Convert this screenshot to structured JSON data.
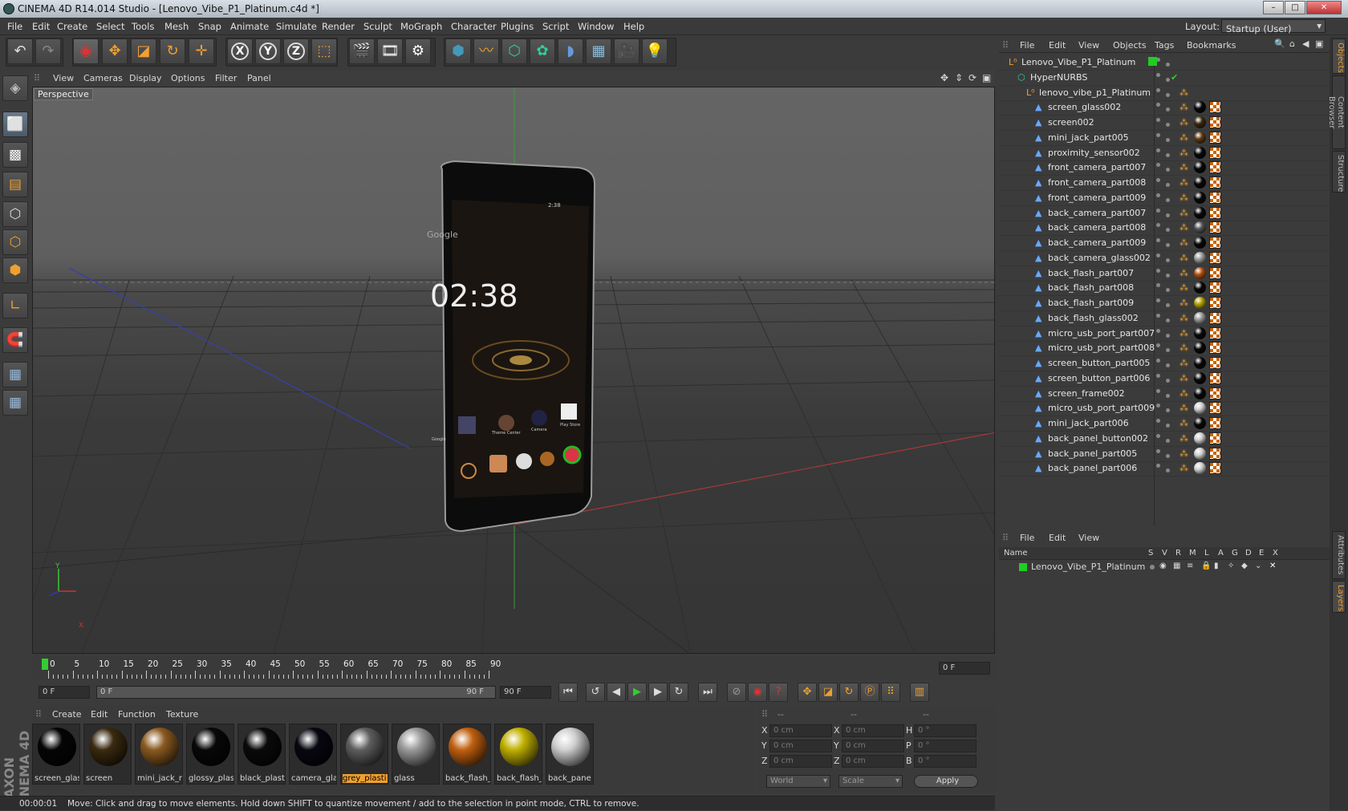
{
  "window": {
    "title": "CINEMA 4D R14.014 Studio - [Lenovo_Vibe_P1_Platinum.c4d *]",
    "min_label": "–",
    "max_label": "□",
    "close_label": "✕"
  },
  "menubar": {
    "items": [
      "File",
      "Edit",
      "Create",
      "Select",
      "Tools",
      "Mesh",
      "Snap",
      "Animate",
      "Simulate",
      "Render",
      "Sculpt",
      "MoGraph",
      "Character",
      "Plugins",
      "Script",
      "Window",
      "Help"
    ],
    "layout_label": "Layout:",
    "layout_value": "Startup (User)"
  },
  "toolbar": {
    "icons": [
      "undo-icon",
      "redo-icon",
      "live-select-icon",
      "move-icon",
      "scale-icon",
      "rotate-icon",
      "recent-tool-icon",
      "x-axis-icon",
      "y-axis-icon",
      "z-axis-icon",
      "coordinate-system-icon",
      "render-view-icon",
      "render-picture-viewer-icon",
      "render-settings-icon",
      "cube-icon",
      "spline-pen-icon",
      "subdivision-surface-icon",
      "array-icon",
      "deformer-icon",
      "floor-icon",
      "camera-icon",
      "light-icon"
    ],
    "axis_labels": [
      "X",
      "Y",
      "Z"
    ]
  },
  "viewport": {
    "menu": [
      "View",
      "Cameras",
      "Display",
      "Options",
      "Filter",
      "Panel"
    ],
    "label": "Perspective",
    "axis_y": "Y",
    "axis_x": "X"
  },
  "phone_screen": {
    "time": "02:38",
    "search": "Google",
    "status_time": "2:38",
    "apps": [
      "Google",
      "Theme Center",
      "Camera",
      "Play Store"
    ]
  },
  "timeline": {
    "ticks": [
      "0",
      "5",
      "10",
      "15",
      "20",
      "25",
      "30",
      "35",
      "40",
      "45",
      "50",
      "55",
      "60",
      "65",
      "70",
      "75",
      "80",
      "85",
      "90"
    ],
    "current_frame": "0 F"
  },
  "playbar": {
    "start": "0 F",
    "range_start": "0 F",
    "range_end": "90 F",
    "end": "90 F"
  },
  "materials": {
    "menu": [
      "Create",
      "Edit",
      "Function",
      "Texture"
    ],
    "items": [
      {
        "label": "screen_glas",
        "color": "#050505"
      },
      {
        "label": "screen",
        "color": "#3a2a10"
      },
      {
        "label": "mini_jack_r",
        "color": "#8a5a20"
      },
      {
        "label": "glossy_plas",
        "color": "#080808"
      },
      {
        "label": "black_plast",
        "color": "#0a0a0a"
      },
      {
        "label": "camera_gla",
        "color": "#070710"
      },
      {
        "label": "grey_plasti",
        "color": "#5e5e5e",
        "selected": true
      },
      {
        "label": "glass",
        "color": "#9a9a9a"
      },
      {
        "label": "back_flash_",
        "color": "#c06010"
      },
      {
        "label": "back_flash_",
        "color": "#c0b000"
      },
      {
        "label": "back_pane",
        "color": "#cfcfcf"
      }
    ]
  },
  "attributes": {
    "header": [
      "--",
      "--",
      "--"
    ],
    "rows": [
      {
        "a": "X",
        "av": "0 cm",
        "b": "X",
        "bv": "0 cm",
        "c": "H",
        "cv": "0 °"
      },
      {
        "a": "Y",
        "av": "0 cm",
        "b": "Y",
        "bv": "0 cm",
        "c": "P",
        "cv": "0 °"
      },
      {
        "a": "Z",
        "av": "0 cm",
        "b": "Z",
        "bv": "0 cm",
        "c": "B",
        "cv": "0 °"
      }
    ],
    "coord_mode": "World",
    "transform_mode": "Scale",
    "apply": "Apply"
  },
  "objects": {
    "menu": [
      "File",
      "Edit",
      "View",
      "Objects",
      "Tags",
      "Bookmarks"
    ],
    "tree": [
      {
        "name": "Lenovo_Vibe_P1_Platinum",
        "depth": 0,
        "kind": "null"
      },
      {
        "name": "HyperNURBS",
        "depth": 1,
        "kind": "nurbs"
      },
      {
        "name": "lenovo_vibe_p1_Platinum",
        "depth": 2,
        "kind": "null"
      },
      {
        "name": "screen_glass002",
        "depth": 3,
        "mat": "#080808"
      },
      {
        "name": "screen002",
        "depth": 3,
        "mat": "#3a2a10"
      },
      {
        "name": "mini_jack_part005",
        "depth": 3,
        "mat": "#5a3a15"
      },
      {
        "name": "proximity_sensor002",
        "depth": 3,
        "mat": "#080808"
      },
      {
        "name": "front_camera_part007",
        "depth": 3,
        "mat": "#080808"
      },
      {
        "name": "front_camera_part008",
        "depth": 3,
        "mat": "#080808"
      },
      {
        "name": "front_camera_part009",
        "depth": 3,
        "mat": "#080808"
      },
      {
        "name": "back_camera_part007",
        "depth": 3,
        "mat": "#080808"
      },
      {
        "name": "back_camera_part008",
        "depth": 3,
        "mat": "#555555"
      },
      {
        "name": "back_camera_part009",
        "depth": 3,
        "mat": "#080808"
      },
      {
        "name": "back_camera_glass002",
        "depth": 3,
        "mat": "#9a9a9a"
      },
      {
        "name": "back_flash_part007",
        "depth": 3,
        "mat": "#b05010"
      },
      {
        "name": "back_flash_part008",
        "depth": 3,
        "mat": "#080808"
      },
      {
        "name": "back_flash_part009",
        "depth": 3,
        "mat": "#b0a000"
      },
      {
        "name": "back_flash_glass002",
        "depth": 3,
        "mat": "#9a9a9a"
      },
      {
        "name": "micro_usb_port_part007",
        "depth": 3,
        "mat": "#080808"
      },
      {
        "name": "micro_usb_port_part008",
        "depth": 3,
        "mat": "#080808"
      },
      {
        "name": "screen_button_part005",
        "depth": 3,
        "mat": "#080808"
      },
      {
        "name": "screen_button_part006",
        "depth": 3,
        "mat": "#080808"
      },
      {
        "name": "screen_frame002",
        "depth": 3,
        "mat": "#080808"
      },
      {
        "name": "micro_usb_port_part009",
        "depth": 3,
        "mat": "#cfcfcf"
      },
      {
        "name": "mini_jack_part006",
        "depth": 3,
        "mat": "#080808"
      },
      {
        "name": "back_panel_button002",
        "depth": 3,
        "mat": "#cfcfcf"
      },
      {
        "name": "back_panel_part005",
        "depth": 3,
        "mat": "#cfcfcf"
      },
      {
        "name": "back_panel_part006",
        "depth": 3,
        "mat": "#cfcfcf"
      }
    ]
  },
  "layers": {
    "menu": [
      "File",
      "Edit",
      "View"
    ],
    "columns": [
      "Name",
      "S",
      "V",
      "R",
      "M",
      "L",
      "A",
      "G",
      "D",
      "E",
      "X"
    ],
    "rows": [
      {
        "name": "Lenovo_Vibe_P1_Platinum",
        "color": "#22cc22"
      }
    ]
  },
  "right_tabs": [
    "Objects",
    "Content Browser",
    "Structure",
    "Attributes",
    "Layers"
  ],
  "status": {
    "time": "00:00:01",
    "message": "Move: Click and drag to move elements. Hold down SHIFT to quantize movement / add to the selection in point mode, CTRL to remove."
  },
  "brand": "MAXON CINEMA 4D"
}
